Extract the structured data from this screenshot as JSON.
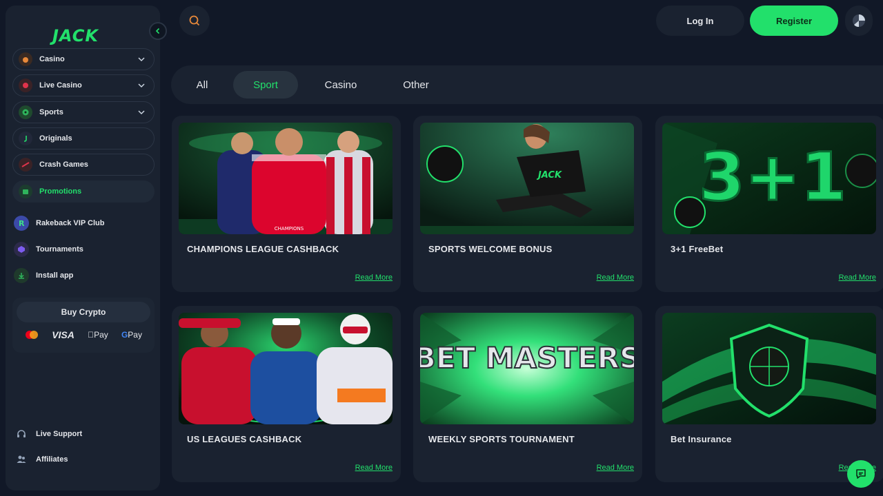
{
  "brand": {
    "logo_text": "JACK",
    "accent_color": "#22e06b"
  },
  "sidebar": {
    "menu": [
      {
        "label": "Casino",
        "icon": "casino-icon",
        "expandable": true
      },
      {
        "label": "Live Casino",
        "icon": "live-casino-icon",
        "expandable": true
      },
      {
        "label": "Sports",
        "icon": "sports-icon",
        "expandable": true
      },
      {
        "label": "Originals",
        "icon": "originals-icon",
        "expandable": false
      },
      {
        "label": "Crash Games",
        "icon": "crash-games-icon",
        "expandable": false
      },
      {
        "label": "Promotions",
        "icon": "promotions-icon",
        "expandable": false,
        "active": true
      }
    ],
    "extras": [
      {
        "label": "Rakeback VIP Club",
        "icon": "rakeback-icon"
      },
      {
        "label": "Tournaments",
        "icon": "tournaments-icon"
      },
      {
        "label": "Install app",
        "icon": "install-app-icon"
      }
    ],
    "buy_crypto": {
      "label": "Buy Crypto",
      "payment_methods": [
        "mastercard-icon",
        "VISA",
        "Pay",
        "Pay"
      ]
    },
    "footer": [
      {
        "label": "Live Support",
        "icon": "headset-icon"
      },
      {
        "label": "Affiliates",
        "icon": "affiliates-icon"
      }
    ]
  },
  "header": {
    "login_label": "Log In",
    "register_label": "Register"
  },
  "tabs": [
    {
      "label": "All",
      "active": false
    },
    {
      "label": "Sport",
      "active": true
    },
    {
      "label": "Casino",
      "active": false
    },
    {
      "label": "Other",
      "active": false
    }
  ],
  "promotions": [
    {
      "title": "CHAMPIONS LEAGUE CASHBACK",
      "link": "Read More"
    },
    {
      "title": "SPORTS WELCOME BONUS",
      "link": "Read More"
    },
    {
      "title": "3+1 FreeBet",
      "link": "Read More",
      "image_text": "3+1"
    },
    {
      "title": "US LEAGUES CASHBACK",
      "link": "Read More"
    },
    {
      "title": "WEEKLY SPORTS TOURNAMENT",
      "link": "Read More",
      "image_text": "BET MASTERS"
    },
    {
      "title": "Bet Insurance",
      "link": "Read More"
    }
  ]
}
